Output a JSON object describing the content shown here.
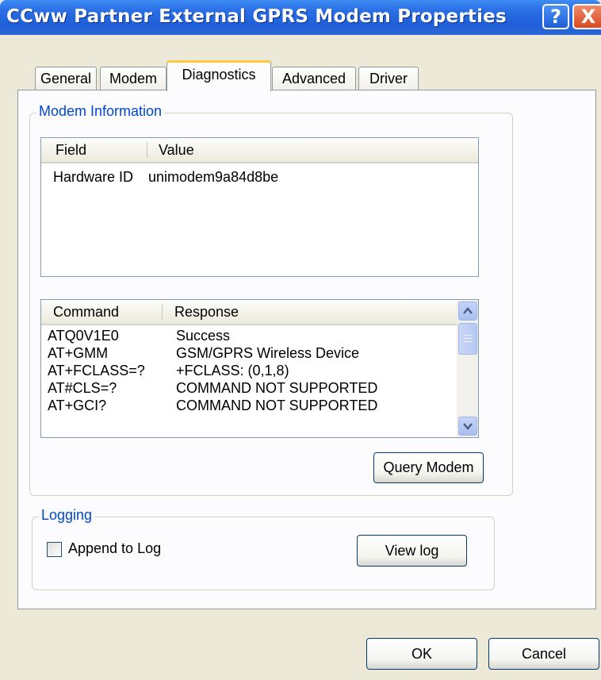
{
  "window": {
    "title": "CCww Partner External GPRS Modem Properties"
  },
  "titlebar_buttons": {
    "help": "?",
    "close": "X"
  },
  "tabs": [
    "General",
    "Modem",
    "Diagnostics",
    "Advanced",
    "Driver"
  ],
  "active_tab": "Diagnostics",
  "modem_info": {
    "group_label": "Modem Information",
    "columns": [
      "Field",
      "Value"
    ],
    "rows": [
      {
        "field": "Hardware ID",
        "value": "unimodem9a84d8be"
      }
    ]
  },
  "commands": {
    "columns": [
      "Command",
      "Response"
    ],
    "rows": [
      {
        "command": "ATQ0V1E0",
        "response": "Success"
      },
      {
        "command": "AT+GMM",
        "response": "GSM/GPRS Wireless Device"
      },
      {
        "command": "AT+FCLASS=?",
        "response": "+FCLASS: (0,1,8)"
      },
      {
        "command": "AT#CLS=?",
        "response": "COMMAND NOT SUPPORTED"
      },
      {
        "command": "AT+GCI?",
        "response": "COMMAND NOT SUPPORTED"
      }
    ]
  },
  "query_button": "Query Modem",
  "logging": {
    "group_label": "Logging",
    "append_label": "Append to Log",
    "append_checked": false,
    "view_log_button": "View log"
  },
  "footer": {
    "ok": "OK",
    "cancel": "Cancel"
  },
  "colors": {
    "titlebar": "#2a6fe6",
    "group_label": "#0046d5",
    "tab_highlight": "#ffc83c"
  }
}
